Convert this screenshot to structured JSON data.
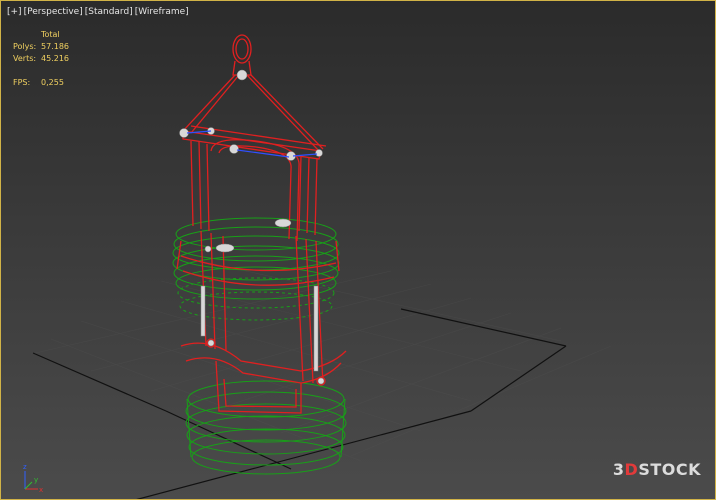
{
  "viewport": {
    "menu": "[+]",
    "view": "[Perspective]",
    "shading": "[Standard]",
    "mode": "[Wireframe]"
  },
  "stats": {
    "header": "Total",
    "polys_label": "Polys:",
    "polys_value": "57.186",
    "verts_label": "Verts:",
    "verts_value": "45.216",
    "fps_label": "FPS:",
    "fps_value": "0,255"
  },
  "watermark": {
    "prefix": "3",
    "accent": "D",
    "rest": "STOCK"
  },
  "gizmo": {
    "x_label": "x",
    "y_label": "y",
    "z_label": "z"
  },
  "colors": {
    "frame_wire": "#e02020",
    "ring_wire": "#18a018",
    "grid": "#111111",
    "stats_text": "#f0d060",
    "viewport_border": "#d1b347"
  }
}
